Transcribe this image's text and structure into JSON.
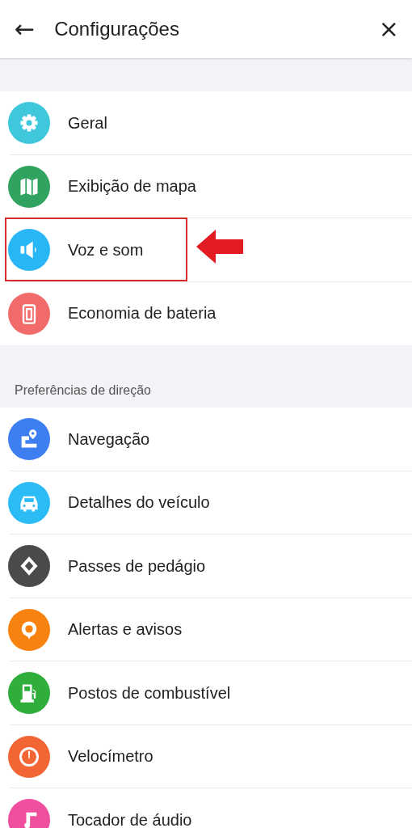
{
  "header": {
    "back": "←",
    "title": "Configurações",
    "close": "×"
  },
  "sections": [
    {
      "items": [
        {
          "label": "Geral",
          "color": "#3fc8dc",
          "highlighted": false
        },
        {
          "label": "Exibição de mapa",
          "color": "#2fa35f",
          "highlighted": false
        },
        {
          "label": "Voz e som",
          "color": "#29b6f6",
          "highlighted": true
        },
        {
          "label": "Economia de bateria",
          "color": "#f26b6b",
          "highlighted": false
        }
      ]
    },
    {
      "heading": "Preferências de direção",
      "items": [
        {
          "label": "Navegação",
          "color": "#3d7ff0",
          "highlighted": false
        },
        {
          "label": "Detalhes do veículo",
          "color": "#2cbcf5",
          "highlighted": false
        },
        {
          "label": "Passes de pedágio",
          "color": "#4a4a4a",
          "highlighted": false
        },
        {
          "label": "Alertas e avisos",
          "color": "#f7820f",
          "highlighted": false
        },
        {
          "label": "Postos de combustível",
          "color": "#2fae3c",
          "highlighted": false
        },
        {
          "label": "Velocímetro",
          "color": "#f26636",
          "highlighted": false
        },
        {
          "label": "Tocador de áudio",
          "color": "#f04fa0",
          "highlighted": false
        }
      ]
    }
  ]
}
